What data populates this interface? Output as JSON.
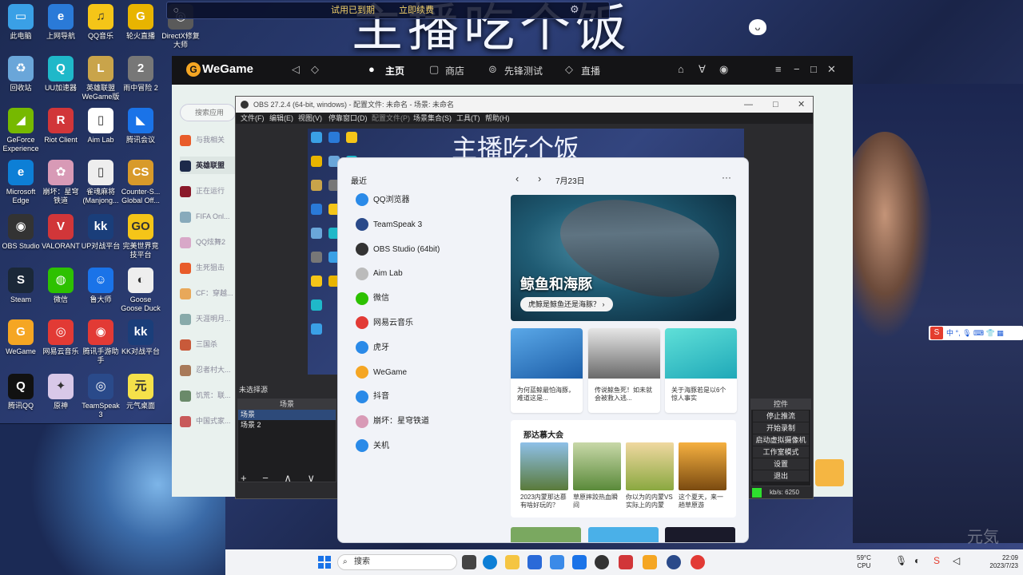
{
  "overlay": {
    "big_title": "主播吃个饭",
    "trial_text": "试用已到期",
    "renew_text": "立即续费"
  },
  "desktop_icons": [
    {
      "label": "此电脑",
      "color": "#3aa0e6",
      "glyph": "▭"
    },
    {
      "label": "上网导航",
      "color": "#2a7ad8",
      "glyph": "e"
    },
    {
      "label": "QQ音乐",
      "color": "#f5c518",
      "glyph": "♫"
    },
    {
      "label": "轮火直播",
      "color": "#e8b400",
      "glyph": "G"
    },
    {
      "label": "DirectX修复大师",
      "color": "#5a5a5a",
      "glyph": "◎"
    },
    {
      "label": "回收站",
      "color": "#6aa6d9",
      "glyph": "♻"
    },
    {
      "label": "UU加速器",
      "color": "#1fb8c9",
      "glyph": "Q"
    },
    {
      "label": "英雄联盟WeGame版",
      "color": "#c9a44a",
      "glyph": "L"
    },
    {
      "label": "雨中冒险 2",
      "color": "#777",
      "glyph": "2"
    },
    {
      "label": "GeForce Experience",
      "color": "#76b900",
      "glyph": "◢"
    },
    {
      "label": "Riot Client",
      "color": "#d13639",
      "glyph": "R"
    },
    {
      "label": "Aim Lab",
      "color": "#fff",
      "glyph": "▯"
    },
    {
      "label": "腾讯会议",
      "color": "#1a73e8",
      "glyph": "◣"
    },
    {
      "label": "Microsoft Edge",
      "color": "#0d7fd6",
      "glyph": "e"
    },
    {
      "label": "崩坏：星穹铁道",
      "color": "#d89ab6",
      "glyph": "✿"
    },
    {
      "label": "雀魂麻将(Manjong...",
      "color": "#eee",
      "glyph": "▯"
    },
    {
      "label": "Counter-S... Global Off...",
      "color": "#d89a2a",
      "glyph": "CS"
    },
    {
      "label": "OBS Studio",
      "color": "#333",
      "glyph": "◉"
    },
    {
      "label": "VALORANT",
      "color": "#d13639",
      "glyph": "V"
    },
    {
      "label": "UP对战平台",
      "color": "#1a3e7a",
      "glyph": "kk"
    },
    {
      "label": "完美世界竞技平台",
      "color": "#f5c518",
      "glyph": "GO"
    },
    {
      "label": "Steam",
      "color": "#1b2838",
      "glyph": "S"
    },
    {
      "label": "微信",
      "color": "#2dc100",
      "glyph": "◍"
    },
    {
      "label": "鲁大师",
      "color": "#1a73e8",
      "glyph": "☺"
    },
    {
      "label": "Goose Goose Duck",
      "color": "#eee",
      "glyph": "◐"
    },
    {
      "label": "WeGame",
      "color": "#f5a623",
      "glyph": "G"
    },
    {
      "label": "网易云音乐",
      "color": "#e23a35",
      "glyph": "◎"
    },
    {
      "label": "腾讯手游助手",
      "color": "#e23a35",
      "glyph": "◉"
    },
    {
      "label": "KK对战平台",
      "color": "#1a3e7a",
      "glyph": "kk"
    },
    {
      "label": "腾讯QQ",
      "color": "#111",
      "glyph": "Q"
    },
    {
      "label": "原神",
      "color": "#d8c8e8",
      "glyph": "✦"
    },
    {
      "label": "TeamSpeak 3",
      "color": "#2a4a8a",
      "glyph": "◎"
    },
    {
      "label": "元气桌面",
      "color": "#f5e14a",
      "glyph": "元"
    }
  ],
  "wegame": {
    "logo": "WeGame",
    "nav": [
      "主页",
      "商店",
      "先锋测试",
      "直播"
    ],
    "search_placeholder": "搜索应用",
    "side_items": [
      "与我相关",
      "英雄联盟",
      "正在运行",
      "FIFA Onl...",
      "QQ炫舞2",
      "生死狙击",
      "CF：穿越...",
      "天涯明月...",
      "三国杀",
      "忍者村大...",
      "饥荒：联...",
      "中国式家..."
    ]
  },
  "obs": {
    "title": "OBS 27.2.4 (64-bit, windows) - 配置文件: 未命名 - 场景: 未命名",
    "menu": [
      "文件(F)",
      "编辑(E)",
      "视图(V)",
      "停靠窗口(D)",
      "配置文件(P)",
      "场景集合(S)",
      "工具(T)",
      "帮助(H)"
    ],
    "preview_title": "主播吃个饭",
    "no_source": "未选择源",
    "scenes_header": "场景",
    "scenes": [
      "场景",
      "场景 2"
    ],
    "scene_buttons": "+ − ∧ ∨",
    "controls_header": "控件",
    "controls": [
      "停止推流",
      "开始录制",
      "启动虚拟摄像机",
      "工作室模式",
      "设置",
      "退出"
    ],
    "status_rate": "kb/s: 6250"
  },
  "startmenu": {
    "recent_title": "最近",
    "recent": [
      {
        "label": "QQ浏览器",
        "color": "#2a8ae8"
      },
      {
        "label": "TeamSpeak 3",
        "color": "#2a4a8a"
      },
      {
        "label": "OBS Studio (64bit)",
        "color": "#333"
      },
      {
        "label": "Aim Lab",
        "color": "#bbb"
      },
      {
        "label": "微信",
        "color": "#2dc100"
      },
      {
        "label": "网易云音乐",
        "color": "#e23a35"
      },
      {
        "label": "虎牙",
        "color": "#2a8ae8"
      },
      {
        "label": "WeGame",
        "color": "#f5a623"
      },
      {
        "label": "抖音",
        "color": "#2a8ae8"
      },
      {
        "label": "崩坏：星穹铁道",
        "color": "#d89ab6"
      },
      {
        "label": "关机",
        "color": "#2a8ae8"
      }
    ],
    "date": "7月23日",
    "hero_title": "鲸鱼和海豚",
    "hero_pill": "虎鲸是鲸鱼还是海豚？ ›",
    "cards": [
      "为何蓝鲸最怕海豚，难道这是...",
      "传说鲸鱼死！如未就会被救入逃...",
      "关于海豚若是以6个惊人事实"
    ],
    "section_title": "那达慕大会",
    "thumbs": [
      "2023内蒙那达慕有啥好玩的？",
      "草原摔跤热血瞬间",
      "你以为的内蒙VS实际上的内蒙",
      "这个夏天，来一趟草原游"
    ]
  },
  "taskbar": {
    "search_placeholder": "搜索",
    "temp": "59°C",
    "cpu": "CPU",
    "time": "22:09",
    "date": "2023/7/23"
  },
  "ime": {
    "label": "中 °, 🎙 ⌨ 👕 ▦"
  },
  "watermark": "元気"
}
